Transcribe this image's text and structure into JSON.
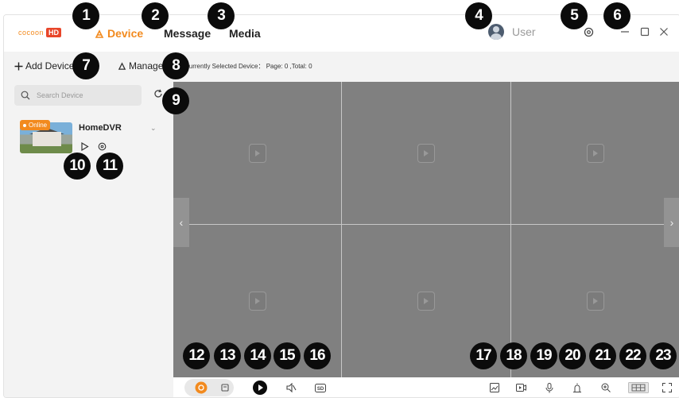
{
  "app": {
    "logo_word": "cocoon",
    "logo_badge": "HD",
    "brand_color": "#f28a1e"
  },
  "nav": {
    "tabs": [
      {
        "label": "Device",
        "active": true
      },
      {
        "label": "Message",
        "active": false
      },
      {
        "label": "Media",
        "active": false
      }
    ]
  },
  "header": {
    "user_label": "User"
  },
  "toolbar": {
    "add_device": "Add Device",
    "manage": "Manage",
    "selected_label": "Currently Selected Device：",
    "page_info": "Page: 0 ,Total: 0"
  },
  "sidebar": {
    "search_placeholder": "Search Device",
    "devices": [
      {
        "name": "HomeDVR",
        "status": "Online"
      }
    ]
  },
  "callouts": [
    "1",
    "2",
    "3",
    "4",
    "5",
    "6",
    "7",
    "8",
    "9",
    "10",
    "11",
    "12",
    "13",
    "14",
    "15",
    "16",
    "17",
    "18",
    "19",
    "20",
    "21",
    "22",
    "23"
  ],
  "icons": {
    "nav": "device-icon",
    "user": "user-avatar-icon",
    "settings": "settings-icon",
    "minimize": "minimize-icon",
    "maximize": "maximize-icon",
    "close": "close-icon",
    "refresh": "refresh-icon",
    "bottom_left": [
      "record-icon",
      "save-icon",
      "play-icon",
      "mute-icon",
      "sd-icon"
    ],
    "bottom_right": [
      "snapshot-icon",
      "video-record-icon",
      "microphone-icon",
      "alarm-icon",
      "zoom-icon",
      "grid-layout-icon",
      "fullscreen-icon"
    ]
  }
}
